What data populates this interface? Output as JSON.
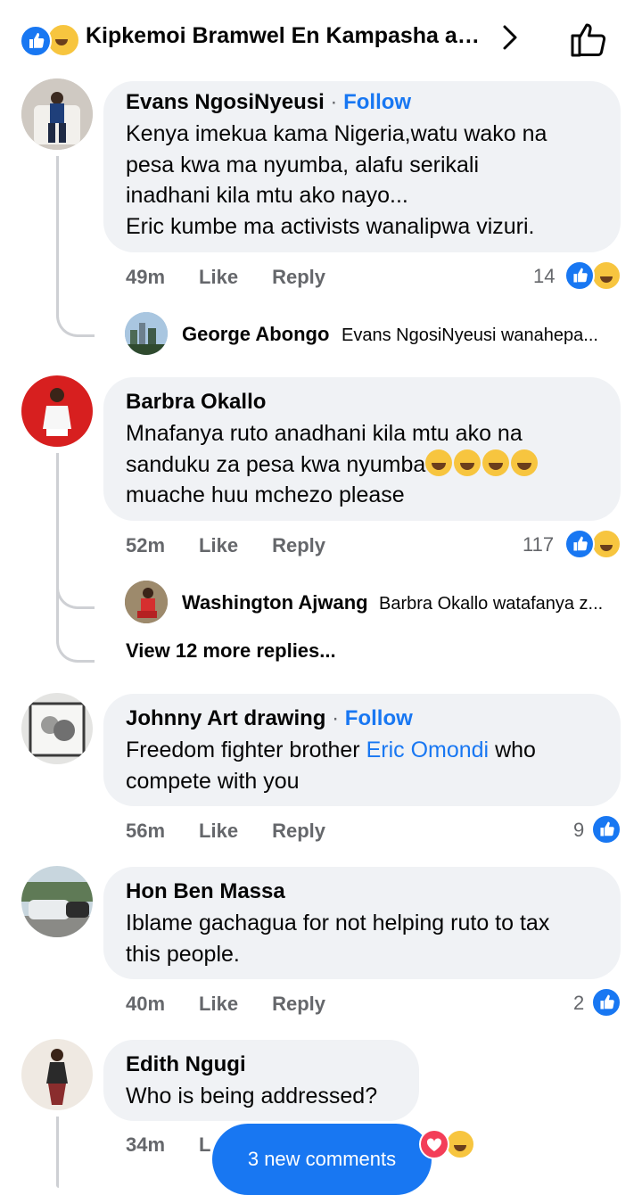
{
  "header": {
    "title": "Kipkemoi Bramwel En Kampasha and...",
    "reaction_icons": [
      "like-icon",
      "haha-icon"
    ],
    "chevron": "chevron-right-icon",
    "action": "thumbs-up-icon"
  },
  "comments": [
    {
      "author": "Evans NgosiNyeusi",
      "separator": "·",
      "follow": "Follow",
      "lines": [
        "Kenya imekua kama Nigeria,watu wako na",
        "pesa kwa ma nyumba, alafu serikali",
        "inadhani kila mtu ako nayo...",
        "Eric kumbe ma activists wanalipwa vizuri."
      ],
      "time": "49m",
      "like": "Like",
      "reply": "Reply",
      "reactions": "14",
      "reply_preview": {
        "author": "George Abongo",
        "snippet": "Evans NgosiNyeusi wanahepa..."
      }
    },
    {
      "author": "Barbra Okallo",
      "lines": [
        "Mnafanya ruto anadhani kila mtu ako na",
        "sanduku za pesa kwa nyumba",
        "muache huu mchezo please"
      ],
      "time": "52m",
      "like": "Like",
      "reply": "Reply",
      "reactions": "117",
      "reply_preview": {
        "author": "Washington Ajwang",
        "snippet": "Barbra Okallo watafanya z..."
      },
      "view_more": "View 12 more replies..."
    },
    {
      "author": "Johnny Art drawing",
      "separator": "·",
      "follow": "Follow",
      "line1_a": "Freedom fighter brother ",
      "line1_link": "Eric Omondi",
      "line1_b": " who",
      "line2": "compete with you",
      "time": "56m",
      "like": "Like",
      "reply": "Reply",
      "reactions": "9"
    },
    {
      "author": "Hon Ben Massa",
      "lines": [
        "Iblame gachagua for not helping ruto to tax",
        "this people."
      ],
      "time": "40m",
      "like": "Like",
      "reply": "Reply",
      "reactions": "2"
    },
    {
      "author": "Edith Ngugi",
      "lines": [
        "Who is being addressed?"
      ],
      "time": "34m",
      "like_partial": "L"
    }
  ],
  "new_comments_pill": "3 new comments",
  "colors": {
    "accent": "#1877f2",
    "bubble": "#f0f2f5",
    "meta": "#65676b"
  }
}
